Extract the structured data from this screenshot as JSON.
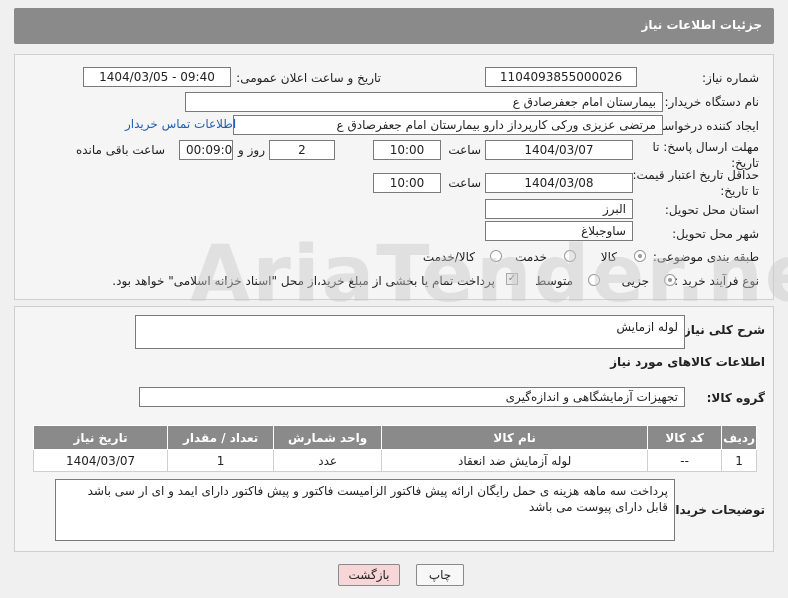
{
  "header": {
    "title": "جزئیات اطلاعات نیاز"
  },
  "form": {
    "need_number_label": "شماره نیاز:",
    "need_number": "1104093855000026",
    "announce_label": "تاریخ و ساعت اعلان عمومی:",
    "announce_value": "1404/03/05 - 09:40",
    "buyer_label": "نام دستگاه خریدار:",
    "buyer_value": "بیمارستان امام جعفرصادق ع",
    "creator_label": "ایجاد کننده درخواست:",
    "creator_value": "مرتضی عزیزی ورکی کارپرداز دارو بیمارستان امام جعفرصادق ع",
    "contact_link": "اطلاعات تماس خریدار",
    "deadline_label": "مهلت ارسال پاسخ: تا تاریخ:",
    "deadline_date": "1404/03/07",
    "time_label": "ساعت",
    "deadline_time": "10:00",
    "days_value": "2",
    "days_label": "روز و",
    "remaining_value": "00:09:06",
    "remaining_label": "ساعت باقی مانده",
    "validity_label": "حداقل تاریخ اعتبار قیمت: تا تاریخ:",
    "validity_date": "1404/03/08",
    "validity_time": "10:00",
    "province_label": "استان محل تحویل:",
    "province_value": "البرز",
    "city_label": "شهر محل تحویل:",
    "city_value": "ساوجبلاغ",
    "category_label": "طبقه بندی موضوعی:",
    "category_options": [
      "کالا",
      "خدمت",
      "کالا/خدمت"
    ],
    "purchase_label": "نوع فرآیند خرید :",
    "purchase_options": [
      "جزیی",
      "متوسط"
    ],
    "payment_note": "پرداخت تمام یا بخشی از مبلغ خرید،از محل \"اسناد خزانه اسلامی\" خواهد بود."
  },
  "details": {
    "desc_label": "شرح کلی نیاز:",
    "desc_value": "لوله ازمایش",
    "goods_title": "اطلاعات کالاهای مورد نیاز",
    "group_label": "گروه کالا:",
    "group_value": "تجهیزات آزمایشگاهی و اندازه‌گیری",
    "table": {
      "headers": [
        "ردیف",
        "کد کالا",
        "نام کالا",
        "واحد شمارش",
        "تعداد / مقدار",
        "تاریخ نیاز"
      ],
      "rows": [
        [
          "1",
          "--",
          "لوله آزمایش ضد انعقاد",
          "عدد",
          "1",
          "1404/03/07"
        ]
      ]
    },
    "notes_label": "توضیحات خریدار:",
    "notes_value": "پرداخت سه ماهه هزینه ی حمل رایگان ارائه پیش فاکتور الزامیست فاکتور و پیش فاکتور دارای ایمد و ای ار سی باشد قابل دارای پیوست می باشد"
  },
  "buttons": {
    "print": "چاپ",
    "back": "بازگشت"
  },
  "watermark": "AriaTender.net",
  "colors": {
    "header_bg": "#8a8a8a",
    "link": "#1f5fb6",
    "back_btn_bg": "#f6d6d6"
  }
}
